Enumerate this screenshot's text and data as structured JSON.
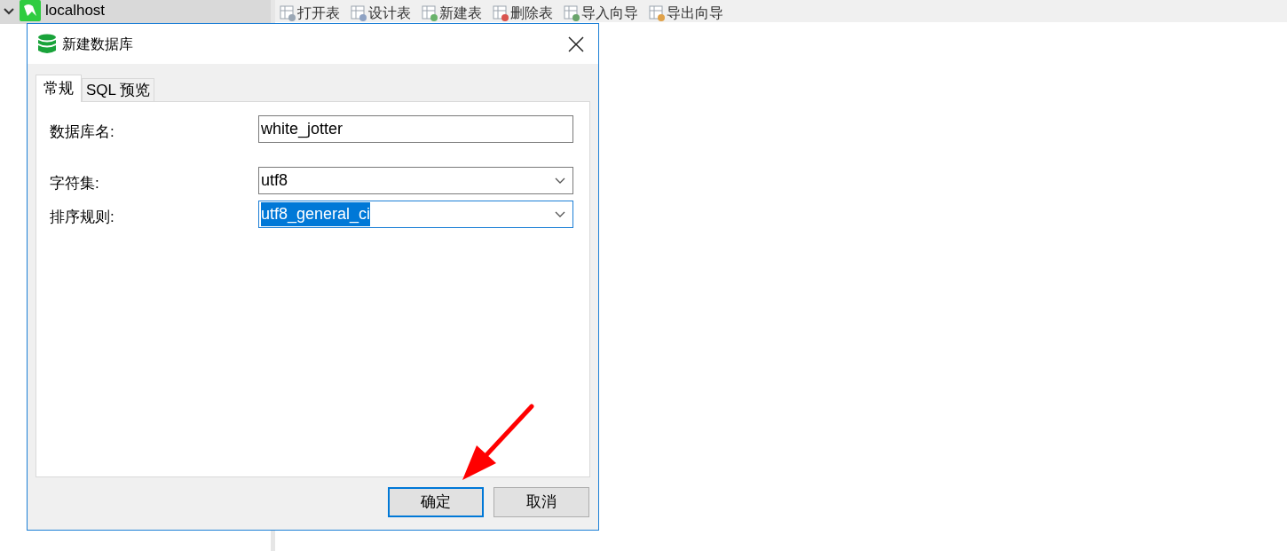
{
  "tree": [
    {
      "label": "localhost",
      "expanded": true,
      "selected": true
    }
  ],
  "toolbar": [
    "打开表",
    "设计表",
    "新建表",
    "删除表",
    "导入向导",
    "导出向导"
  ],
  "dialog": {
    "title": "新建数据库",
    "tabs": [
      {
        "label": "常规",
        "selected": true
      },
      {
        "label": "SQL 预览",
        "selected": false
      }
    ],
    "fields": [
      {
        "label": "数据库名:",
        "kind": "text",
        "value": "white_jotter",
        "highlighted": false
      },
      {
        "label": "字符集:",
        "kind": "dropdown",
        "value": "utf8",
        "highlighted": false
      },
      {
        "label": "排序规则:",
        "kind": "dropdown",
        "value": "utf8_general_ci",
        "highlighted": true
      }
    ],
    "buttons": [
      {
        "label": "确定",
        "default": true
      },
      {
        "label": "取消",
        "default": false
      }
    ]
  }
}
